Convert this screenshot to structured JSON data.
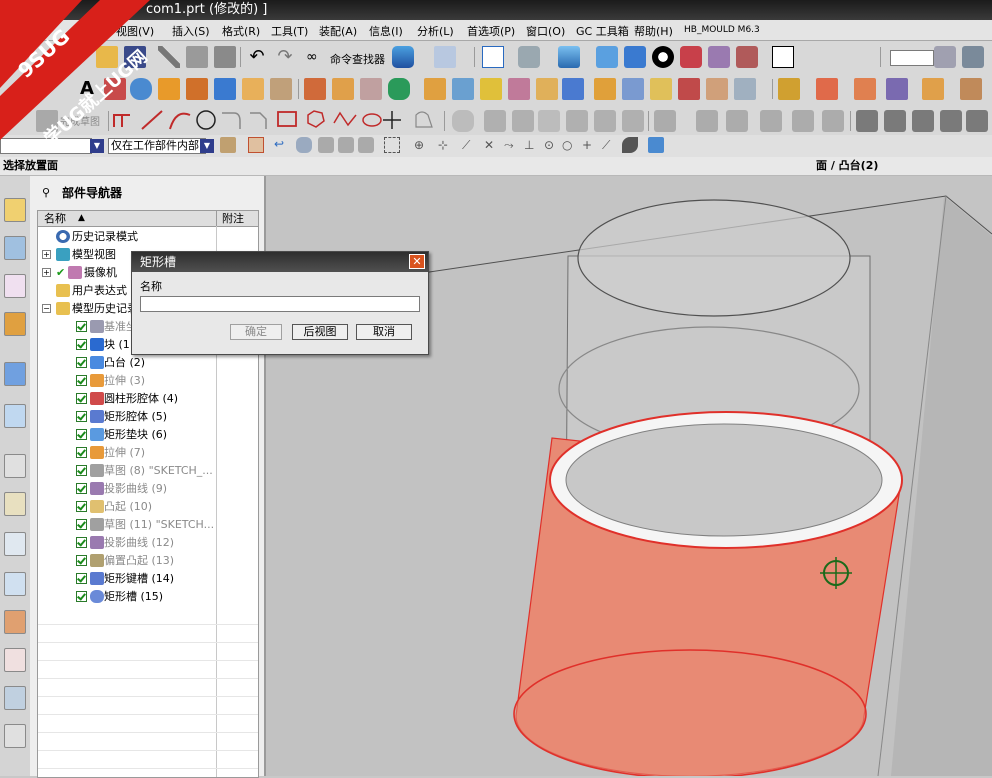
{
  "window": {
    "title": "com1.prt (修改的) ]"
  },
  "menu": [
    "视图(V)",
    "插入(S)",
    "格式(R)",
    "工具(T)",
    "装配(A)",
    "信息(I)",
    "分析(L)",
    "首选项(P)",
    "窗口(O)",
    "GC 工具箱",
    "帮助(H)",
    "HB_MOULD M6.3"
  ],
  "toolbar": {
    "command_finder_label": "命令查找器",
    "finish_sketch_label": "完成草图",
    "selection_scope_value": "仅在工作部件内部"
  },
  "status": {
    "left_text": "选择放置面",
    "right_text": "面 / 凸台(2)"
  },
  "watermark": {
    "line1": "9SUG",
    "line2": "学UG就上UG网"
  },
  "navigator": {
    "title": "部件导航器",
    "col_name": "名称",
    "col_note": "附注",
    "items": [
      {
        "label": "历史记录模式",
        "gray": false
      },
      {
        "label": "模型视图",
        "gray": false
      },
      {
        "label": "摄像机",
        "gray": false
      },
      {
        "label": "用户表达式",
        "gray": false
      },
      {
        "label": "模型历史记录",
        "gray": false
      },
      {
        "label": "基准坐",
        "gray": true
      },
      {
        "label": "块 (1",
        "gray": false
      },
      {
        "label": "凸台 (2)",
        "gray": false
      },
      {
        "label": "拉伸 (3)",
        "gray": true
      },
      {
        "label": "圆柱形腔体 (4)",
        "gray": false
      },
      {
        "label": "矩形腔体 (5)",
        "gray": false
      },
      {
        "label": "矩形垫块 (6)",
        "gray": false
      },
      {
        "label": "拉伸 (7)",
        "gray": true
      },
      {
        "label": "草图 (8) \"SKETCH_...",
        "gray": true
      },
      {
        "label": "投影曲线 (9)",
        "gray": true
      },
      {
        "label": "凸起 (10)",
        "gray": true
      },
      {
        "label": "草图 (11) \"SKETCH...",
        "gray": true
      },
      {
        "label": "投影曲线 (12)",
        "gray": true
      },
      {
        "label": "偏置凸起 (13)",
        "gray": true
      },
      {
        "label": "矩形键槽 (14)",
        "gray": false
      },
      {
        "label": "矩形槽 (15)",
        "gray": false
      }
    ]
  },
  "dialog": {
    "title": "矩形槽",
    "name_label": "名称",
    "name_value": "",
    "ok_label": "确定",
    "back_label": "后视图",
    "cancel_label": "取消"
  },
  "colors": {
    "title_bg": "#2a2a2a",
    "dialog_close": "#d9531e",
    "cylinder_face": "#e88a74",
    "cylinder_edge": "#e0302a",
    "check_green": "#1a8a1a"
  }
}
